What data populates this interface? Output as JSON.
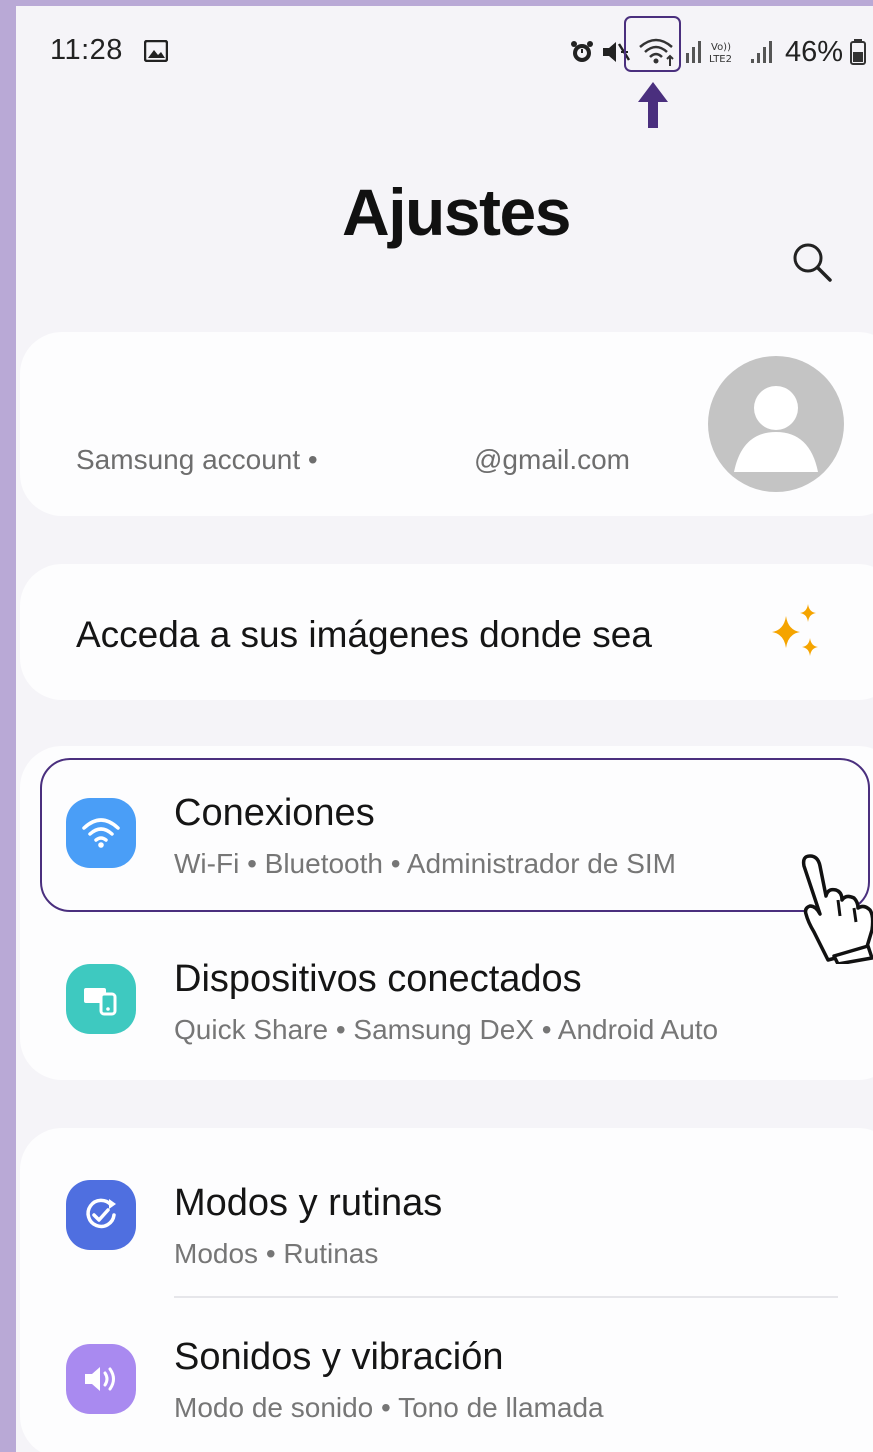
{
  "status_bar": {
    "time": "11:28",
    "battery_percent": "46%",
    "icons": [
      "gallery-icon",
      "alarm-icon",
      "mute-icon",
      "wifi-icon",
      "signal-icon",
      "volte-icon",
      "signal-icon",
      "battery-icon"
    ],
    "highlight_color": "#4a2f7e"
  },
  "header": {
    "title": "Ajustes"
  },
  "account": {
    "label": "Samsung account  •",
    "email": "@gmail.com"
  },
  "promo": {
    "text": "Acceda a sus imágenes donde sea",
    "sparkle_color": "#f5a400"
  },
  "settings": {
    "connections": {
      "title": "Conexiones",
      "subtitle": "Wi-Fi  •  Bluetooth  •  Administrador de SIM",
      "icon_color": "#4a9ef7"
    },
    "connected_devices": {
      "title": "Dispositivos conectados",
      "subtitle": "Quick Share  •  Samsung DeX  •  Android Auto",
      "icon_color": "#3ec9c0"
    },
    "modes": {
      "title": "Modos y rutinas",
      "subtitle": "Modos  •  Rutinas",
      "icon_color": "#4f6fe0"
    },
    "sounds": {
      "title": "Sonidos y vibración",
      "subtitle": "Modo de sonido  •  Tono de llamada",
      "icon_color": "#a98af0"
    }
  }
}
